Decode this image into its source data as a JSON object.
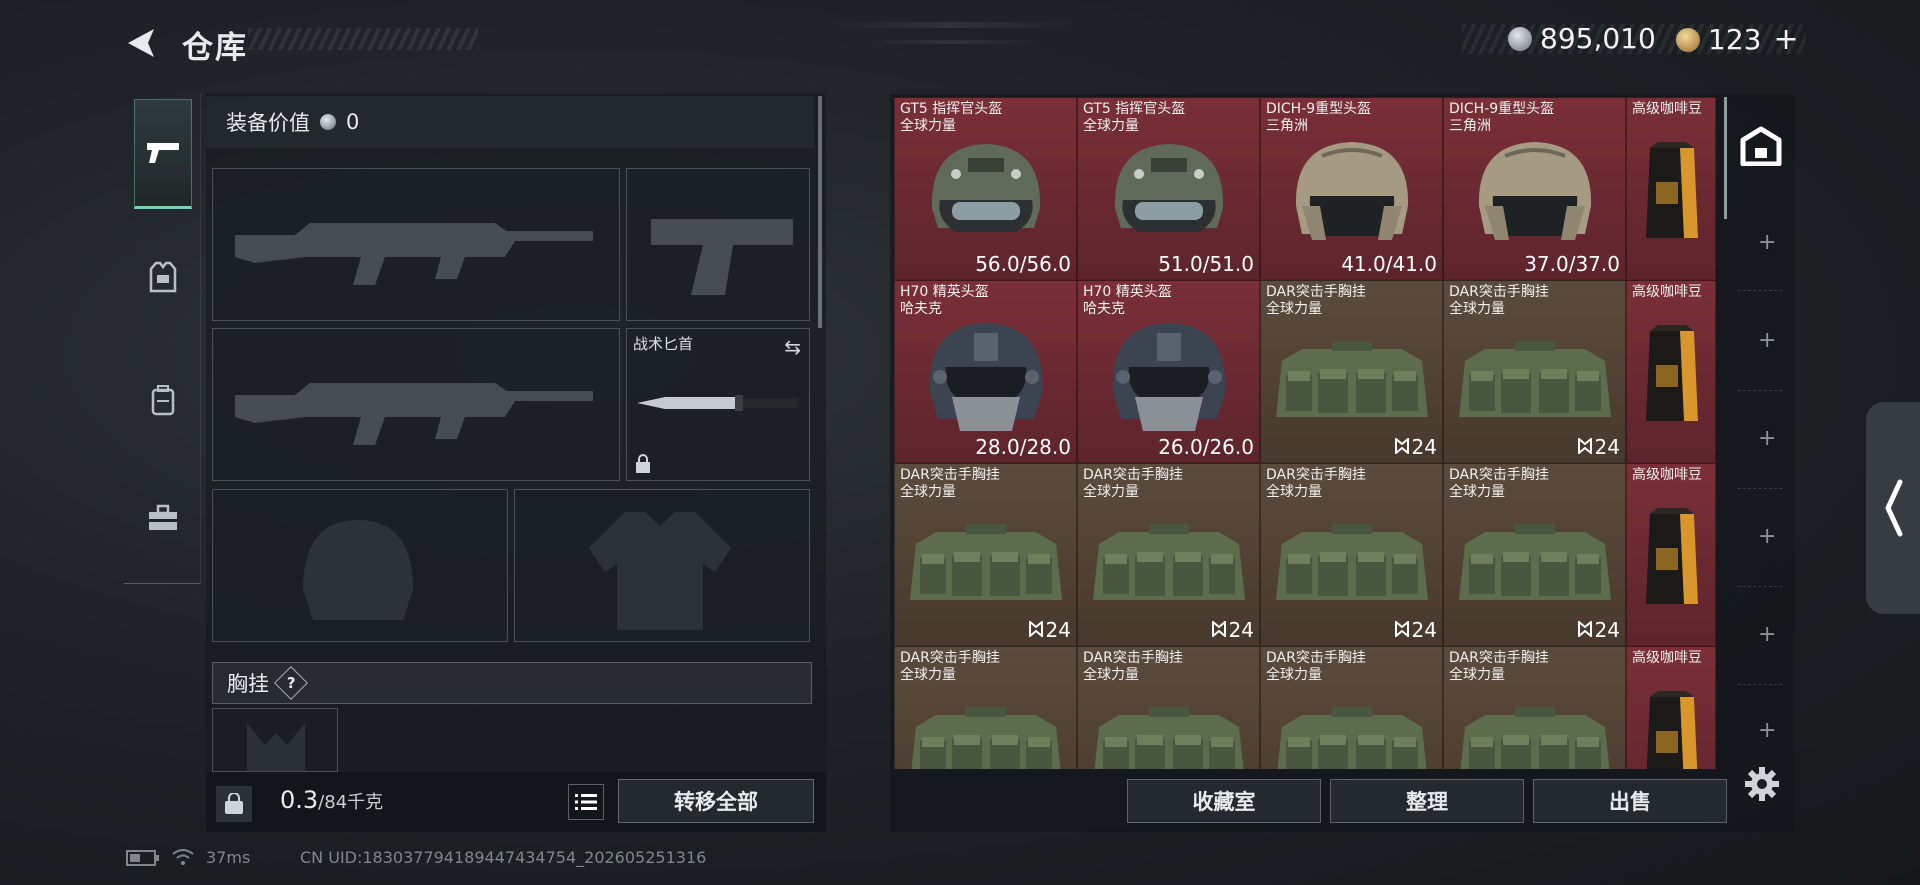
{
  "header": {
    "title": "仓库"
  },
  "currency": {
    "silver": "895,010",
    "gold": "123",
    "add_label": "+"
  },
  "equipment": {
    "value_label": "装备价值",
    "value": "0"
  },
  "slots": {
    "melee_name": "战术匕首"
  },
  "chest_rig": {
    "label": "胸挂",
    "help": "?"
  },
  "footer": {
    "weight_current": "0.3",
    "weight_max": "/84千克",
    "transfer_all": "转移全部"
  },
  "stash_items": [
    {
      "name": "GT5 指挥官头盔",
      "sub": "全球力量",
      "value": "56.0/56.0",
      "bg": "red",
      "kind": "helmet-green"
    },
    {
      "name": "GT5 指挥官头盔",
      "sub": "全球力量",
      "value": "51.0/51.0",
      "bg": "red",
      "kind": "helmet-green"
    },
    {
      "name": "DICH-9重型头盔",
      "sub": "三角洲",
      "value": "41.0/41.0",
      "bg": "red",
      "kind": "helmet-tan"
    },
    {
      "name": "DICH-9重型头盔",
      "sub": "三角洲",
      "value": "37.0/37.0",
      "bg": "red",
      "kind": "helmet-tan"
    },
    {
      "name": "高级咖啡豆",
      "sub": "",
      "value": "",
      "bg": "red",
      "kind": "coffee"
    },
    {
      "name": "H70 精英头盔",
      "sub": "哈夫克",
      "value": "28.0/28.0",
      "bg": "red",
      "kind": "helmet-dark"
    },
    {
      "name": "H70 精英头盔",
      "sub": "哈夫克",
      "value": "26.0/26.0",
      "bg": "red",
      "kind": "helmet-dark"
    },
    {
      "name": "DAR突击手胸挂",
      "sub": "全球力量",
      "value": "24",
      "bg": "brown",
      "kind": "rig"
    },
    {
      "name": "DAR突击手胸挂",
      "sub": "全球力量",
      "value": "24",
      "bg": "brown",
      "kind": "rig"
    },
    {
      "name": "高级咖啡豆",
      "sub": "",
      "value": "",
      "bg": "red",
      "kind": "coffee"
    },
    {
      "name": "DAR突击手胸挂",
      "sub": "全球力量",
      "value": "24",
      "bg": "brown",
      "kind": "rig"
    },
    {
      "name": "DAR突击手胸挂",
      "sub": "全球力量",
      "value": "24",
      "bg": "brown",
      "kind": "rig"
    },
    {
      "name": "DAR突击手胸挂",
      "sub": "全球力量",
      "value": "24",
      "bg": "brown",
      "kind": "rig"
    },
    {
      "name": "DAR突击手胸挂",
      "sub": "全球力量",
      "value": "24",
      "bg": "brown",
      "kind": "rig"
    },
    {
      "name": "高级咖啡豆",
      "sub": "",
      "value": "",
      "bg": "red",
      "kind": "coffee"
    },
    {
      "name": "DAR突击手胸挂",
      "sub": "全球力量",
      "value": "",
      "bg": "brown",
      "kind": "rig"
    },
    {
      "name": "DAR突击手胸挂",
      "sub": "全球力量",
      "value": "",
      "bg": "brown",
      "kind": "rig"
    },
    {
      "name": "DAR突击手胸挂",
      "sub": "全球力量",
      "value": "",
      "bg": "brown",
      "kind": "rig"
    },
    {
      "name": "DAR突击手胸挂",
      "sub": "全球力量",
      "value": "",
      "bg": "brown",
      "kind": "rig"
    },
    {
      "name": "高级咖啡豆",
      "sub": "",
      "value": "",
      "bg": "red",
      "kind": "coffee"
    }
  ],
  "actions": {
    "collection": "收藏室",
    "organize": "整理",
    "sell": "出售"
  },
  "status": {
    "ping": "37ms",
    "uid": "CN UID:183037794189447434754_202605251316"
  },
  "colors": {
    "accent": "#6fd7b0",
    "red_cell": "#6e2a33",
    "brown_cell": "#54453a"
  }
}
